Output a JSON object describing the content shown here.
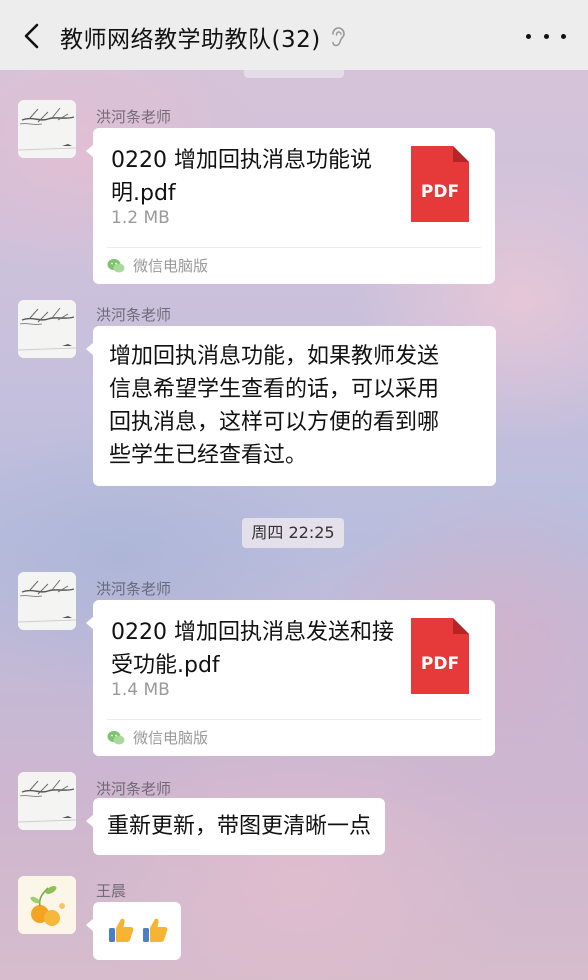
{
  "header": {
    "title": "教师网络教学助教队(32)",
    "back_icon": "chevron-left-icon",
    "mute_icon": "ear-icon",
    "more_icon": "more-dots-icon"
  },
  "messages": [
    {
      "sender": "洪河条老师",
      "type": "file",
      "file_name": "0220 增加回执消息功能说明.pdf",
      "file_size": "1.2 MB",
      "file_type": "PDF",
      "source": "微信电脑版"
    },
    {
      "sender": "洪河条老师",
      "type": "text",
      "text": "增加回执消息功能，如果教师发送\n信息希望学生查看的话，可以采用\n回执消息，这样可以方便的看到哪\n些学生已经查看过。"
    },
    {
      "type": "time",
      "text": "周四 22:25"
    },
    {
      "sender": "洪河条老师",
      "type": "file",
      "file_name": "0220 增加回执消息发送和接受功能.pdf",
      "file_size": "1.4 MB",
      "file_type": "PDF",
      "source": "微信电脑版"
    },
    {
      "sender": "洪河条老师",
      "type": "text",
      "text": "重新更新，带图更清晰一点"
    },
    {
      "sender": "王晨",
      "type": "emoji",
      "emoji": "👍👍"
    }
  ],
  "colors": {
    "header_bg": "#ededed",
    "pdf_red": "#e5393a",
    "bubble_bg": "#ffffff"
  }
}
